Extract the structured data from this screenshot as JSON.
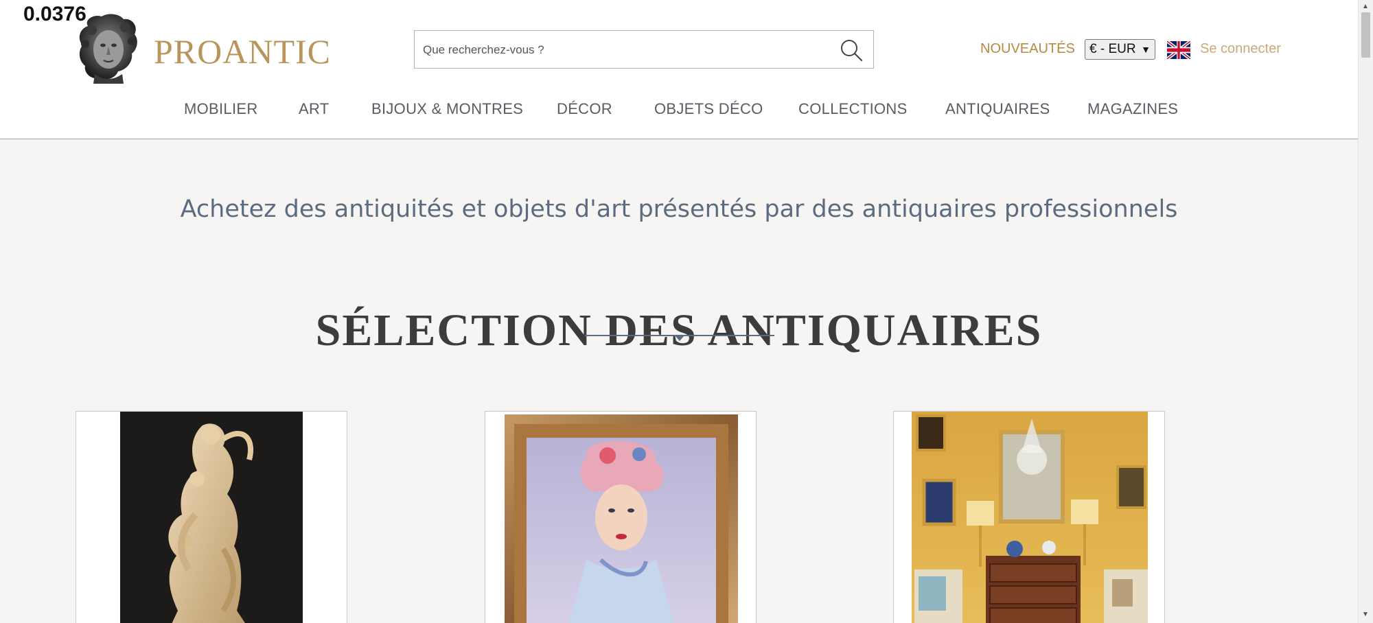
{
  "overlay": {
    "value": "0.0376"
  },
  "brand": {
    "name": "PROANTIC",
    "color": "#b8955a"
  },
  "search": {
    "placeholder": "Que recherchez-vous ?",
    "icon": "search-icon"
  },
  "header_links": {
    "news": "NOUVEAUTÉS",
    "currency": "€ - EUR",
    "language_flag": "uk-flag-icon",
    "login": "Se connecter"
  },
  "nav": {
    "items": [
      {
        "label": "MOBILIER"
      },
      {
        "label": "ART"
      },
      {
        "label": "BIJOUX & MONTRES"
      },
      {
        "label": "DÉCOR"
      },
      {
        "label": "OBJETS DÉCO"
      },
      {
        "label": "COLLECTIONS"
      },
      {
        "label": "ANTIQUAIRES"
      },
      {
        "label": "MAGAZINES"
      }
    ]
  },
  "main": {
    "tagline": "Achetez des antiquités et objets d'art présentés par des antiquaires professionnels",
    "section_title": "SÉLECTION DES ANTIQUAIRES",
    "cards": [
      {
        "image": "ivory-sculpture-image"
      },
      {
        "image": "framed-portrait-painting-image"
      },
      {
        "image": "antique-interior-image"
      }
    ]
  },
  "colors": {
    "accent_gold": "#b58a3e",
    "nav_text": "#555c64",
    "tagline_blue": "#5c6b80",
    "background": "#f6f5f4"
  }
}
